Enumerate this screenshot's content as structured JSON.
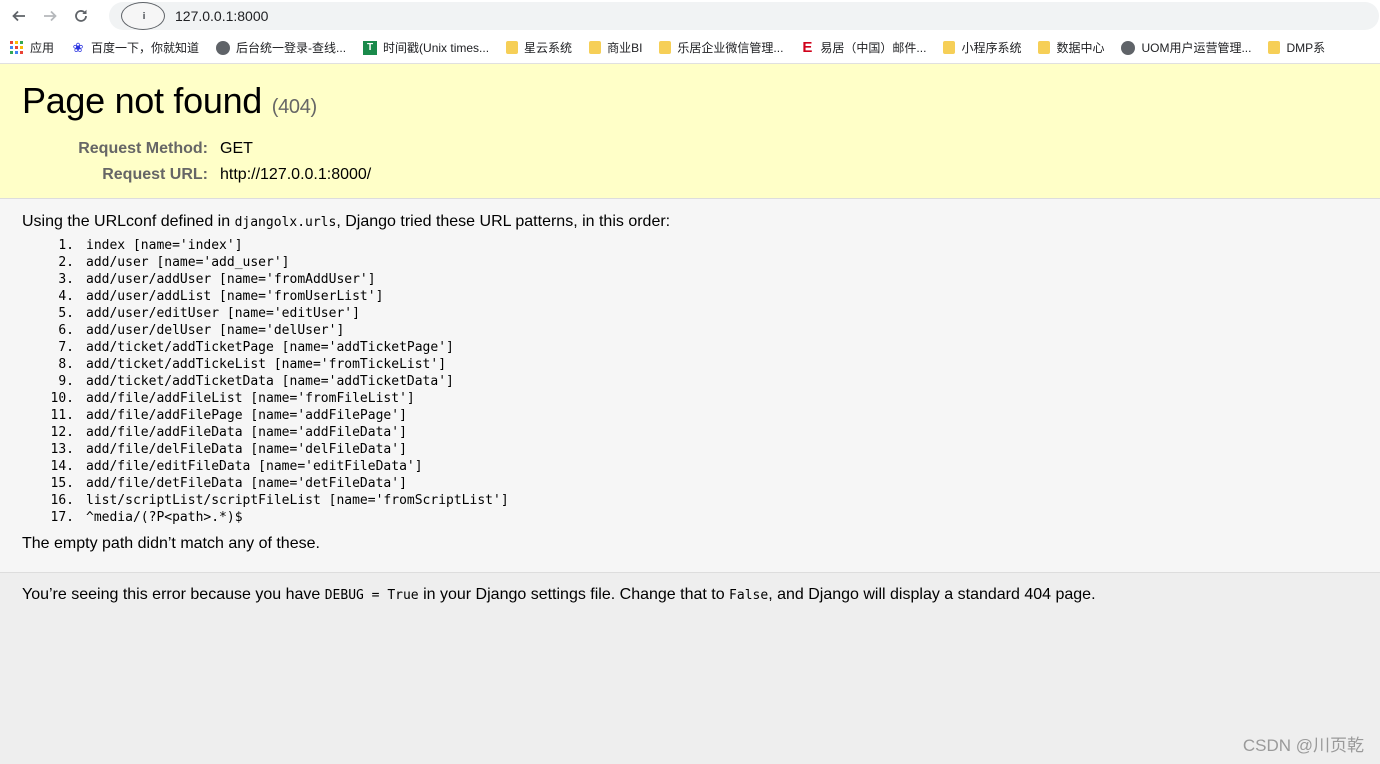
{
  "browser": {
    "url": "127.0.0.1:8000",
    "bookmarks": [
      {
        "label": "应用",
        "icon": "apps-icon"
      },
      {
        "label": "百度一下，你就知道",
        "icon": "baidu-icon"
      },
      {
        "label": "后台统一登录-查线...",
        "icon": "globe-icon"
      },
      {
        "label": "时间戳(Unix times...",
        "icon": "t-icon"
      },
      {
        "label": "星云系统",
        "icon": "folder-icon"
      },
      {
        "label": "商业BI",
        "icon": "folder-icon"
      },
      {
        "label": "乐居企业微信管理...",
        "icon": "folder-icon"
      },
      {
        "label": "易居（中国）邮件...",
        "icon": "e-icon"
      },
      {
        "label": "小程序系统",
        "icon": "folder-icon"
      },
      {
        "label": "数据中心",
        "icon": "folder-icon"
      },
      {
        "label": "UOM用户运营管理...",
        "icon": "globe-icon"
      },
      {
        "label": "DMP系",
        "icon": "folder-icon"
      }
    ]
  },
  "summary": {
    "title": "Page not found",
    "status": "(404)",
    "method_label": "Request Method:",
    "method_value": "GET",
    "url_label": "Request URL:",
    "url_value": "http://127.0.0.1:8000/"
  },
  "info": {
    "intro_pre": "Using the URLconf defined in ",
    "intro_code": "djangolx.urls",
    "intro_post": ", Django tried these URL patterns, in this order:",
    "patterns": [
      "index [name='index']",
      "add/user [name='add_user']",
      "add/user/addUser [name='fromAddUser']",
      "add/user/addList [name='fromUserList']",
      "add/user/editUser [name='editUser']",
      "add/user/delUser [name='delUser']",
      "add/ticket/addTicketPage [name='addTicketPage']",
      "add/ticket/addTickeList [name='fromTickeList']",
      "add/ticket/addTicketData [name='addTicketData']",
      "add/file/addFileList [name='fromFileList']",
      "add/file/addFilePage [name='addFilePage']",
      "add/file/addFileData [name='addFileData']",
      "add/file/delFileData [name='delFileData']",
      "add/file/editFileData [name='editFileData']",
      "add/file/detFileData [name='detFileData']",
      "list/scriptList/scriptFileList [name='fromScriptList']",
      "^media/(?P<path>.*)$"
    ],
    "tail": "The empty path didn’t match any of these."
  },
  "explanation": {
    "pre": "You’re seeing this error because you have ",
    "code1": "DEBUG = True",
    "mid": " in your Django settings file. Change that to ",
    "code2": "False",
    "post": ", and Django will display a standard 404 page."
  },
  "watermark": "CSDN @川页乾"
}
